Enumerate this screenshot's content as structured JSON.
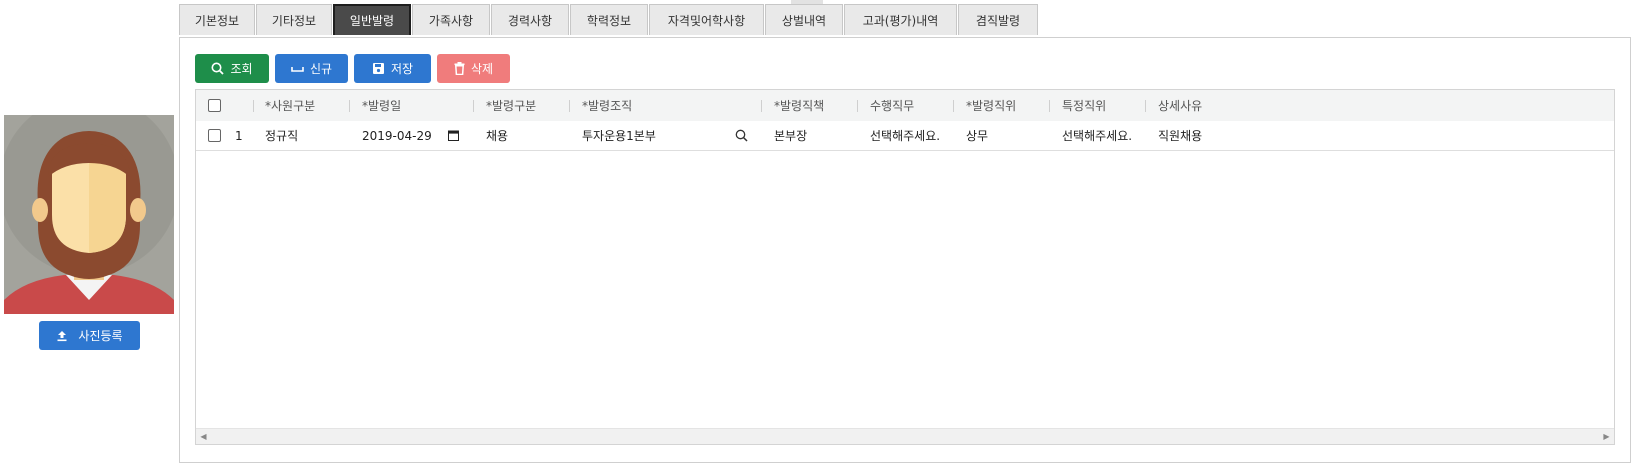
{
  "tabs": [
    {
      "label": "기본정보"
    },
    {
      "label": "기타정보"
    },
    {
      "label": "일반발령",
      "active": true
    },
    {
      "label": "가족사항"
    },
    {
      "label": "경력사항"
    },
    {
      "label": "학력정보"
    },
    {
      "label": "자격및어학사항"
    },
    {
      "label": "상벌내역"
    },
    {
      "label": "고과(평가)내역"
    },
    {
      "label": "겸직발령"
    }
  ],
  "photo": {
    "upload_label": "사진등록",
    "upload_icon": "upload-icon"
  },
  "toolbar": {
    "search_label": "조회",
    "new_label": "신규",
    "save_label": "저장",
    "delete_label": "삭제"
  },
  "grid": {
    "columns": [
      "*사원구분",
      "*발령일",
      "*발령구분",
      "*발령조직",
      "*발령직책",
      "수행직무",
      "*발령직위",
      "특정직위",
      "상세사유"
    ],
    "rows": [
      {
        "no": "1",
        "employee_type": "정규직",
        "date": "2019-04-29",
        "order_type": "채용",
        "org": "투자운용1본부",
        "position": "본부장",
        "duty": "선택해주세요.",
        "rank": "상무",
        "special_rank": "선택해주세요.",
        "reason": "직원채용"
      }
    ]
  },
  "colors": {
    "green": "#1e8e4a",
    "blue": "#2e77d0",
    "pink": "#f07c7c",
    "active_tab": "#4a4a4a"
  }
}
